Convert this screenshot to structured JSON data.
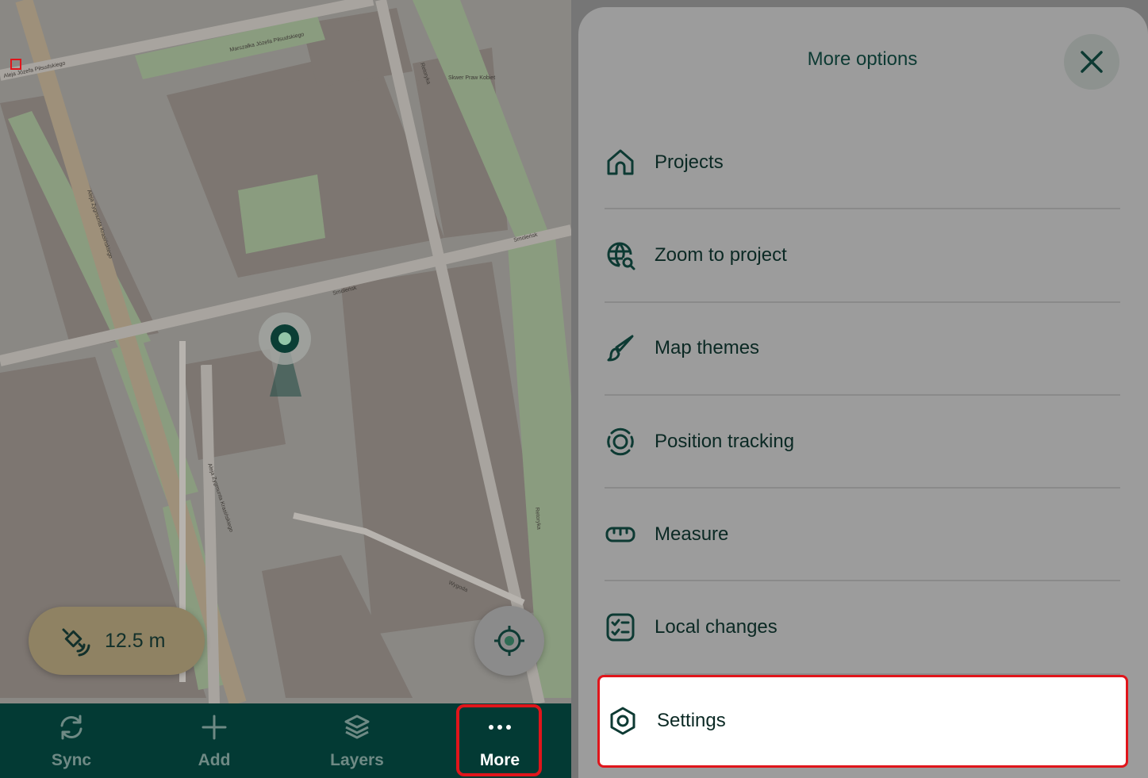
{
  "map": {
    "street_labels": [
      "Smoleńsk",
      "Smoleńsk",
      "Wygoda",
      "Retoryka",
      "Retoryka",
      "Aleja Zygmunta Krasińskiego",
      "Aleja Zygmunta Krasińskiego",
      "Aleja Józefa Piłsudskiego",
      "Marszałka Józefa Piłsudskiego",
      "Skwer Praw Kobiet"
    ],
    "accuracy": {
      "icon": "satellite-icon",
      "value": "12.5 m"
    },
    "gps_button": {
      "icon": "crosshair-icon"
    }
  },
  "bottom_nav": {
    "items": [
      {
        "label": "Sync",
        "icon": "sync-icon"
      },
      {
        "label": "Add",
        "icon": "plus-icon"
      },
      {
        "label": "Layers",
        "icon": "layers-icon"
      },
      {
        "label": "More",
        "icon": "more-dots-icon"
      }
    ]
  },
  "sheet": {
    "title": "More options",
    "close_icon": "close-icon",
    "items": [
      {
        "label": "Projects",
        "icon": "home-icon"
      },
      {
        "label": "Zoom to project",
        "icon": "globe-search-icon"
      },
      {
        "label": "Map themes",
        "icon": "brush-icon"
      },
      {
        "label": "Position tracking",
        "icon": "tracking-icon"
      },
      {
        "label": "Measure",
        "icon": "ruler-icon"
      },
      {
        "label": "Local changes",
        "icon": "checklist-icon"
      },
      {
        "label": "Settings",
        "icon": "settings-icon"
      }
    ]
  },
  "colors": {
    "nav_bg": "#033a34",
    "accent": "#0d3a33",
    "highlight": "#e0151b",
    "pill": "#8f8263"
  }
}
